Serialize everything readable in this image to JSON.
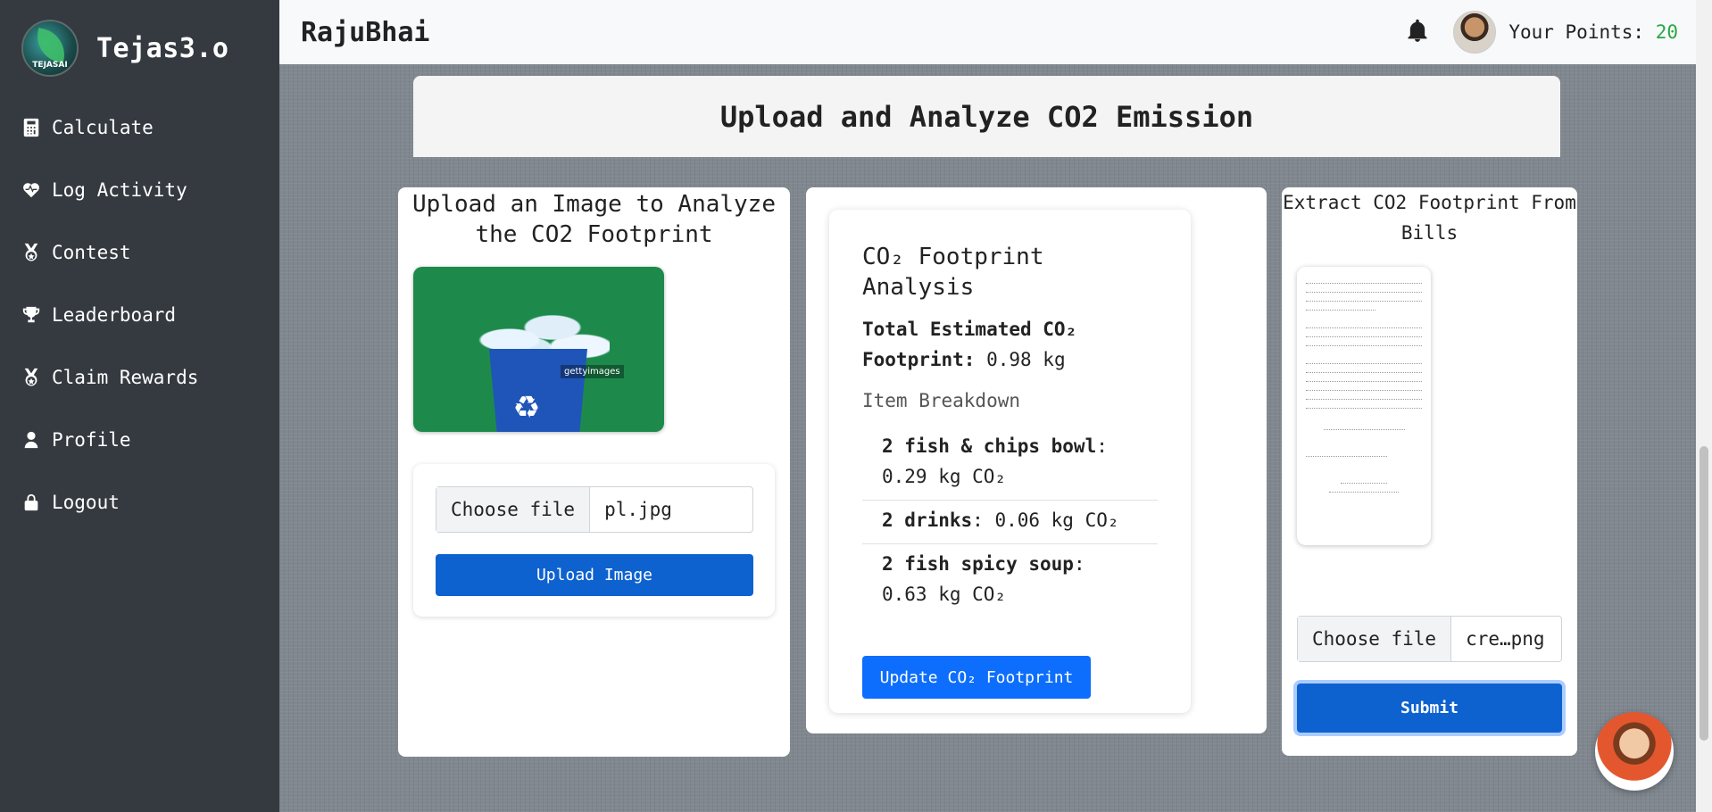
{
  "sidebar": {
    "brand": "Tejas3.o",
    "logo_text": "TEJASAI",
    "items": [
      {
        "label": "Calculate",
        "icon": "calculator-icon"
      },
      {
        "label": "Log Activity",
        "icon": "heartbeat-icon"
      },
      {
        "label": "Contest",
        "icon": "medal-icon"
      },
      {
        "label": "Leaderboard",
        "icon": "trophy-icon"
      },
      {
        "label": "Claim Rewards",
        "icon": "medal-icon"
      },
      {
        "label": "Profile",
        "icon": "user-icon"
      },
      {
        "label": "Logout",
        "icon": "lock-icon"
      }
    ]
  },
  "header": {
    "username": "RajuBhai",
    "points_label": "Your Points:",
    "points_value": "20"
  },
  "page": {
    "title": "Upload and Analyze CO2 Emission"
  },
  "image_card": {
    "title": "Upload an Image to Analyze the CO2 Footprint",
    "watermark": "gettyimages",
    "file_button": "Choose file",
    "file_name": "pl.jpg",
    "upload_button": "Upload Image"
  },
  "analysis": {
    "title": "CO₂ Footprint Analysis",
    "total_label": "Total Estimated CO₂ Footprint:",
    "total_value": "0.98 kg",
    "breakdown_label": "Item Breakdown",
    "items": [
      {
        "name": "2 fish & chips bowl",
        "value": ": 0.29 kg CO₂"
      },
      {
        "name": "2 drinks",
        "value": ": 0.06 kg CO₂"
      },
      {
        "name": "2 fish spicy soup",
        "value": ": 0.63 kg CO₂"
      }
    ],
    "update_button": "Update CO₂ Footprint"
  },
  "bill_card": {
    "title": "Extract CO2 Footprint From Bills",
    "file_button": "Choose file",
    "file_name": "cre…png",
    "submit_button": "Submit"
  }
}
